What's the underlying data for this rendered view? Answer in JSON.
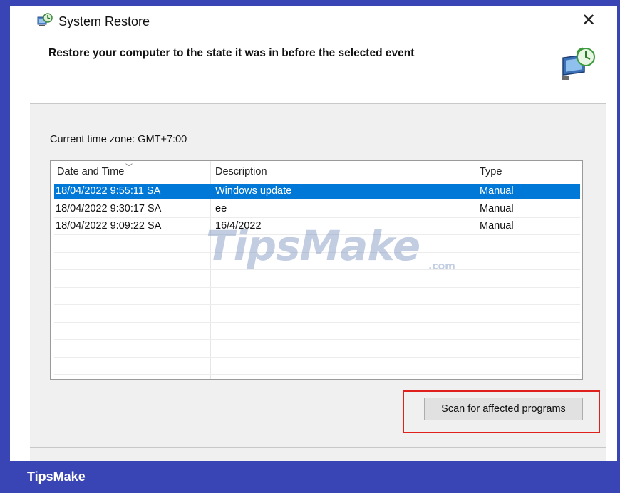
{
  "window": {
    "title": "System Restore",
    "close_glyph": "✕",
    "heading": "Restore your computer to the state it was in before the selected event"
  },
  "icons": {
    "app": "system-restore-icon",
    "header": "restore-computer-icon"
  },
  "panel": {
    "timezone_label": "Current time zone: GMT+7:00",
    "columns": [
      "Date and Time",
      "Description",
      "Type"
    ],
    "sort_glyph": "﹀",
    "rows": [
      {
        "date": "18/04/2022 9:55:11 SA",
        "description": "Windows update",
        "type": "Manual",
        "selected": true
      },
      {
        "date": "18/04/2022 9:30:17 SA",
        "description": "ee",
        "type": "Manual",
        "selected": false
      },
      {
        "date": "18/04/2022 9:09:22 SA",
        "description": "16/4/2022",
        "type": "Manual",
        "selected": false
      }
    ],
    "scan_button": "Scan for affected programs"
  },
  "watermark": {
    "text": "TipsMake",
    "suffix": ".com"
  },
  "footer": {
    "brand": "TipsMake"
  },
  "colors": {
    "frame": "#3a45b5",
    "selection": "#0078d7",
    "highlight": "#e0201c"
  }
}
